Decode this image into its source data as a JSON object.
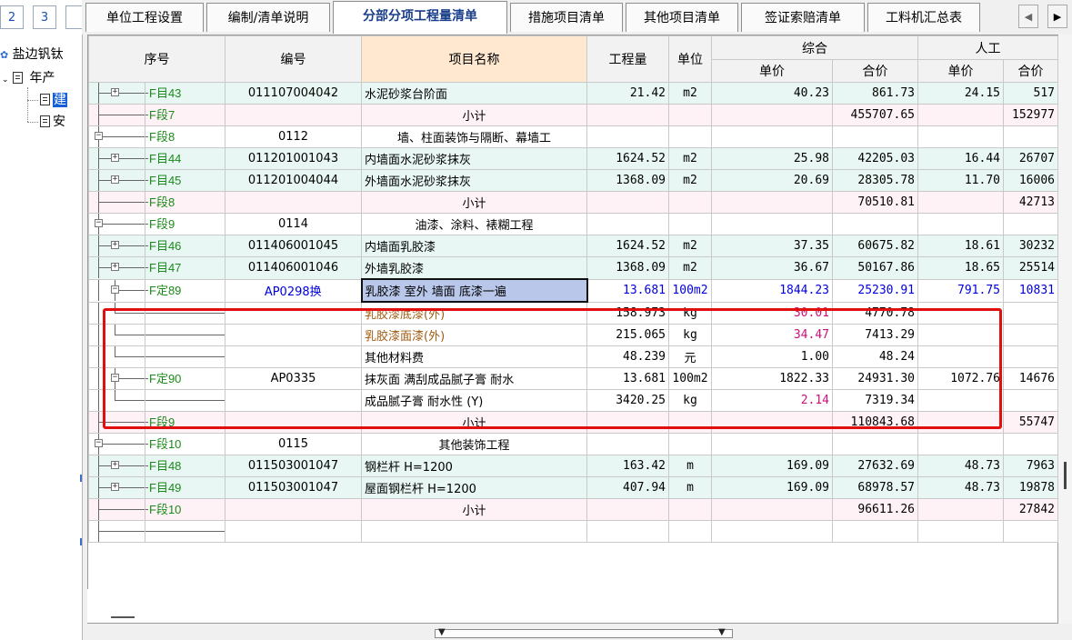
{
  "page_tabs": [
    "2",
    "3"
  ],
  "tree": {
    "root": "盐边钒钛",
    "child": "年产",
    "leaf1": "建",
    "leaf2": "安"
  },
  "tabs": [
    "单位工程设置",
    "编制/清单说明",
    "分部分项工程量清单",
    "措施项目清单",
    "其他项目清单",
    "签证索赔清单",
    "工料机汇总表"
  ],
  "active_tab": "分部分项工程量清单",
  "headers": {
    "seq": "序号",
    "code": "编号",
    "name": "项目名称",
    "qty": "工程量",
    "unit": "单位",
    "composite": "综合",
    "labor": "人工",
    "unit_price": "单价",
    "total_price": "合价"
  },
  "rows": [
    {
      "kind": "item",
      "seq": "F目43",
      "code": "011107004042",
      "name": "水泥砂浆台阶面",
      "qty": "21.42",
      "unit": "m2",
      "cu": "40.23",
      "ct": "861.73",
      "lu": "24.15",
      "lt": "517"
    },
    {
      "kind": "subtotal",
      "seq": "F段7",
      "code": "",
      "name": "小计",
      "qty": "",
      "unit": "",
      "cu": "",
      "ct": "455707.65",
      "lu": "",
      "lt": "152977"
    },
    {
      "kind": "section",
      "seq": "F段8",
      "code": "0112",
      "name": "墙、柱面装饰与隔断、幕墙工",
      "qty": "",
      "unit": "",
      "cu": "",
      "ct": "",
      "lu": "",
      "lt": ""
    },
    {
      "kind": "item",
      "seq": "F目44",
      "code": "011201001043",
      "name": "内墙面水泥砂浆抹灰",
      "qty": "1624.52",
      "unit": "m2",
      "cu": "25.98",
      "ct": "42205.03",
      "lu": "16.44",
      "lt": "26707"
    },
    {
      "kind": "item",
      "seq": "F目45",
      "code": "011201004044",
      "name": "外墙面水泥砂浆抹灰",
      "qty": "1368.09",
      "unit": "m2",
      "cu": "20.69",
      "ct": "28305.78",
      "lu": "11.70",
      "lt": "16006"
    },
    {
      "kind": "subtotal",
      "seq": "F段8",
      "code": "",
      "name": "小计",
      "qty": "",
      "unit": "",
      "cu": "",
      "ct": "70510.81",
      "lu": "",
      "lt": "42713"
    },
    {
      "kind": "section",
      "seq": "F段9",
      "code": "0114",
      "name": "油漆、涂料、裱糊工程",
      "qty": "",
      "unit": "",
      "cu": "",
      "ct": "",
      "lu": "",
      "lt": ""
    },
    {
      "kind": "item",
      "seq": "F目46",
      "code": "011406001045",
      "name": "内墙面乳胶漆",
      "qty": "1624.52",
      "unit": "m2",
      "cu": "37.35",
      "ct": "60675.82",
      "lu": "18.61",
      "lt": "30232"
    },
    {
      "kind": "item",
      "seq": "F目47",
      "code": "011406001046",
      "name": "外墙乳胶漆",
      "qty": "1368.09",
      "unit": "m2",
      "cu": "36.67",
      "ct": "50167.86",
      "lu": "18.65",
      "lt": "25514"
    },
    {
      "kind": "quota",
      "seq": "F定89",
      "code": "AP0298换",
      "name": "乳胶漆 室外 墙面 底漆一遍",
      "qty": "13.681",
      "unit": "100m2",
      "cu": "1844.23",
      "ct": "25230.91",
      "lu": "791.75",
      "lt": "10831"
    },
    {
      "kind": "material",
      "seq": "",
      "code": "",
      "name": "乳胶漆底漆(外)",
      "qty": "158.973",
      "unit": "kg",
      "cu": "30.01",
      "ct": "4770.78",
      "lu": "",
      "lt": ""
    },
    {
      "kind": "material",
      "seq": "",
      "code": "",
      "name": "乳胶漆面漆(外)",
      "qty": "215.065",
      "unit": "kg",
      "cu": "34.47",
      "ct": "7413.29",
      "lu": "",
      "lt": ""
    },
    {
      "kind": "material2",
      "seq": "",
      "code": "",
      "name": "其他材料费",
      "qty": "48.239",
      "unit": "元",
      "cu": "1.00",
      "ct": "48.24",
      "lu": "",
      "lt": ""
    },
    {
      "kind": "quota2",
      "seq": "F定90",
      "code": "AP0335",
      "name": "抹灰面 满刮成品腻子膏 耐水",
      "qty": "13.681",
      "unit": "100m2",
      "cu": "1822.33",
      "ct": "24931.30",
      "lu": "1072.76",
      "lt": "14676"
    },
    {
      "kind": "material3",
      "seq": "",
      "code": "",
      "name": "成品腻子膏 耐水性 (Y)",
      "qty": "3420.25",
      "unit": "kg",
      "cu": "2.14",
      "ct": "7319.34",
      "lu": "",
      "lt": ""
    },
    {
      "kind": "subtotal",
      "seq": "F段9",
      "code": "",
      "name": "小计",
      "qty": "",
      "unit": "",
      "cu": "",
      "ct": "110843.68",
      "lu": "",
      "lt": "55747"
    },
    {
      "kind": "section",
      "seq": "F段10",
      "code": "0115",
      "name": "其他装饰工程",
      "qty": "",
      "unit": "",
      "cu": "",
      "ct": "",
      "lu": "",
      "lt": ""
    },
    {
      "kind": "item",
      "seq": "F目48",
      "code": "011503001047",
      "name": "钢栏杆 H=1200",
      "qty": "163.42",
      "unit": "m",
      "cu": "169.09",
      "ct": "27632.69",
      "lu": "48.73",
      "lt": "7963"
    },
    {
      "kind": "item",
      "seq": "F目49",
      "code": "011503001047",
      "name": "屋面钢栏杆 H=1200",
      "qty": "407.94",
      "unit": "m",
      "cu": "169.09",
      "ct": "68978.57",
      "lu": "48.73",
      "lt": "19878"
    },
    {
      "kind": "subtotal",
      "seq": "F段10",
      "code": "",
      "name": "小计",
      "qty": "",
      "unit": "",
      "cu": "",
      "ct": "96611.26",
      "lu": "",
      "lt": "27842"
    },
    {
      "kind": "empty",
      "seq": "",
      "code": "",
      "name": "",
      "qty": "",
      "unit": "",
      "cu": "",
      "ct": "",
      "lu": "",
      "lt": ""
    }
  ],
  "colors": {
    "highlight_border": "#e01010",
    "item_bg": "#e8f7f3",
    "subtotal_bg": "#fff2f7",
    "name_header_bg": "#ffe8cf"
  }
}
